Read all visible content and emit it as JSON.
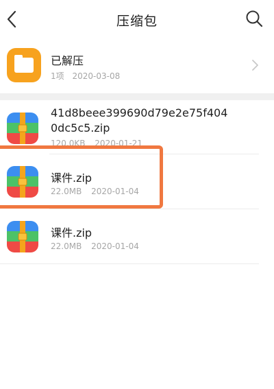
{
  "header": {
    "title": "压缩包",
    "back_icon": "chevron-left-icon",
    "search_icon": "search-icon"
  },
  "folder": {
    "name": "已解压",
    "count": "1项",
    "date": "2020-03-08",
    "icon": "folder-icon",
    "color": "#f7a21e"
  },
  "files": [
    {
      "name_line1": "41d8beee399690d79e2e75f404",
      "name_line2": "0dc5c5.zip",
      "size": "120.0KB",
      "date": "2020-01-21"
    },
    {
      "name_line1": "课件.zip",
      "size": "22.0MB",
      "date": "2020-01-04"
    },
    {
      "name_line1": "课件.zip",
      "size": "22.0MB",
      "date": "2020-01-04"
    }
  ],
  "colors": {
    "highlight": "#f07840",
    "zip_blue": "#3c8ef0",
    "zip_green": "#4cc267",
    "zip_red": "#ef4a45",
    "zip_orange": "#f4a51c"
  }
}
